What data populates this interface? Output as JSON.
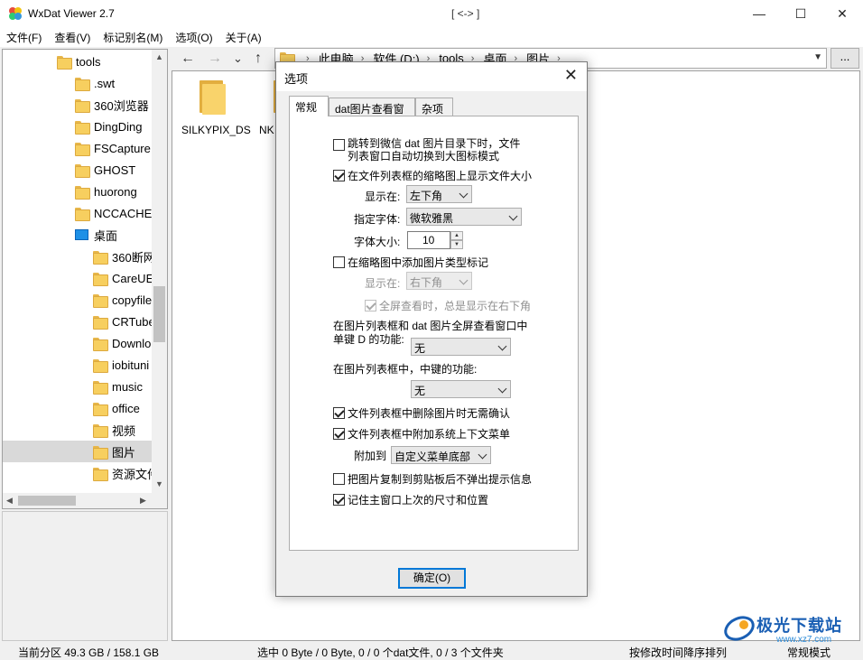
{
  "window": {
    "title": "WxDat Viewer 2.7",
    "center_title": "[ <-> ]",
    "min_glyph": "—",
    "max_glyph": "☐",
    "close_glyph": "✕"
  },
  "menu": [
    "文件(F)",
    "查看(V)",
    "标记别名(M)",
    "选项(O)",
    "关于(A)"
  ],
  "tree": {
    "items": [
      {
        "label": "tools",
        "indent": 1,
        "icon": "folder"
      },
      {
        "label": ".swt",
        "indent": 2,
        "icon": "folder"
      },
      {
        "label": "360浏览器",
        "indent": 2,
        "icon": "folder"
      },
      {
        "label": "DingDing",
        "indent": 2,
        "icon": "folder"
      },
      {
        "label": "FSCapture",
        "indent": 2,
        "icon": "folder"
      },
      {
        "label": "GHOST",
        "indent": 2,
        "icon": "folder"
      },
      {
        "label": "huorong",
        "indent": 2,
        "icon": "folder"
      },
      {
        "label": "NCCACHE",
        "indent": 2,
        "icon": "folder"
      },
      {
        "label": "桌面",
        "indent": 2,
        "icon": "desktop"
      },
      {
        "label": "360断网",
        "indent": 3,
        "icon": "folder"
      },
      {
        "label": "CareUEy",
        "indent": 3,
        "icon": "folder"
      },
      {
        "label": "copyfile",
        "indent": 3,
        "icon": "folder"
      },
      {
        "label": "CRTube",
        "indent": 3,
        "icon": "folder"
      },
      {
        "label": "Downlo",
        "indent": 3,
        "icon": "folder"
      },
      {
        "label": "iobituni",
        "indent": 3,
        "icon": "folder"
      },
      {
        "label": "music",
        "indent": 3,
        "icon": "folder"
      },
      {
        "label": "office",
        "indent": 3,
        "icon": "folder"
      },
      {
        "label": "视频",
        "indent": 3,
        "icon": "folder"
      },
      {
        "label": "图片",
        "indent": 3,
        "icon": "folder",
        "selected": true
      },
      {
        "label": "资源文件",
        "indent": 3,
        "icon": "folder"
      }
    ]
  },
  "nav": {
    "back": "←",
    "forward": "→",
    "history": "⌄",
    "up": "↑",
    "more": "..."
  },
  "address": [
    "此电脑",
    "软件 (D:)",
    "tools",
    "桌面",
    "图片"
  ],
  "files": [
    "SILKYPIX_DS",
    "NK"
  ],
  "status": {
    "partition": "当前分区 49.3 GB / 158.1 GB",
    "selection": "选中 0 Byte / 0 Byte,  0 / 0 个dat文件,  0 / 3 个文件夹",
    "sort": "按修改时间降序排列",
    "mode": "常规模式"
  },
  "dialog": {
    "title": "选项",
    "tabs": [
      "常规",
      "dat图片查看窗口",
      "杂项"
    ],
    "opt_jump_line1": "跳转到微信 dat 图片目录下时，文件",
    "opt_jump_line2": "列表窗口自动切换到大图标模式",
    "opt_jump_checked": false,
    "opt_show_size": "在文件列表框的缩略图上显示文件大小",
    "opt_show_size_checked": true,
    "show_at_label": "显示在:",
    "show_at_value": "左下角",
    "font_label": "指定字体:",
    "font_value": "微软雅黑",
    "font_size_label": "字体大小:",
    "font_size_value": "10",
    "opt_type_mark": "在缩略图中添加图片类型标记",
    "opt_type_mark_checked": false,
    "show_at2_label": "显示在:",
    "show_at2_value": "右下角",
    "opt_fullscreen": "全屏查看时，总是显示在右下角",
    "opt_fullscreen_checked": true,
    "dkey_line1": "在图片列表框和 dat 图片全屏查看窗口中",
    "dkey_line2": "单键 D 的功能:",
    "dkey_value": "无",
    "middle_label": "在图片列表框中，中键的功能:",
    "middle_value": "无",
    "opt_no_confirm": "文件列表框中删除图片时无需确认",
    "opt_no_confirm_checked": true,
    "opt_context_menu": "文件列表框中附加系统上下文菜单",
    "opt_context_menu_checked": true,
    "attach_label": "附加到",
    "attach_value": "自定义菜单底部",
    "opt_copy_tip": "把图片复制到剪贴板后不弹出提示信息",
    "opt_copy_tip_checked": false,
    "opt_remember": "记住主窗口上次的尺寸和位置",
    "opt_remember_checked": true,
    "ok_label": "确定(O)"
  },
  "watermark": {
    "text": "极光下载站",
    "url": "www.xz7.com"
  }
}
